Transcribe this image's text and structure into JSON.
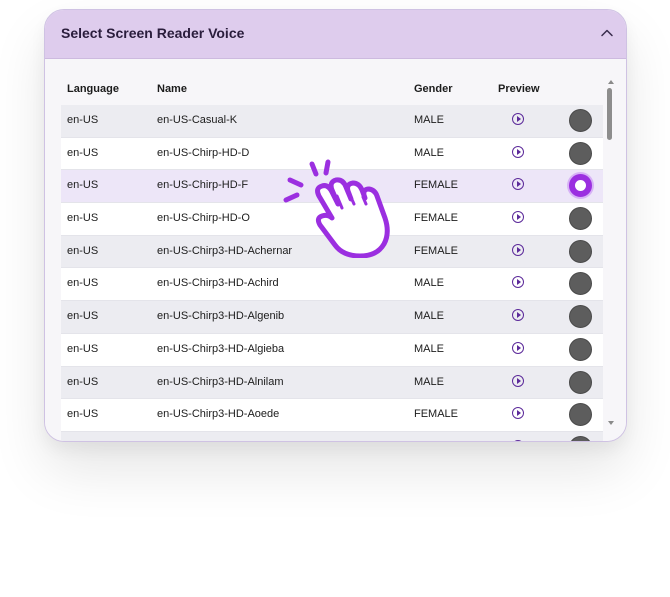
{
  "dialog": {
    "title": "Select Screen Reader Voice",
    "collapse_icon": "chevron-up-icon"
  },
  "table": {
    "headers": {
      "language": "Language",
      "name": "Name",
      "gender": "Gender",
      "preview": "Preview"
    },
    "preview_icon": "play-circle-icon",
    "rows": [
      {
        "language": "en-US",
        "name": "en-US-Casual-K",
        "gender": "MALE",
        "selected": false
      },
      {
        "language": "en-US",
        "name": "en-US-Chirp-HD-D",
        "gender": "MALE",
        "selected": false
      },
      {
        "language": "en-US",
        "name": "en-US-Chirp-HD-F",
        "gender": "FEMALE",
        "selected": true
      },
      {
        "language": "en-US",
        "name": "en-US-Chirp-HD-O",
        "gender": "FEMALE",
        "selected": false
      },
      {
        "language": "en-US",
        "name": "en-US-Chirp3-HD-Achernar",
        "gender": "FEMALE",
        "selected": false
      },
      {
        "language": "en-US",
        "name": "en-US-Chirp3-HD-Achird",
        "gender": "MALE",
        "selected": false
      },
      {
        "language": "en-US",
        "name": "en-US-Chirp3-HD-Algenib",
        "gender": "MALE",
        "selected": false
      },
      {
        "language": "en-US",
        "name": "en-US-Chirp3-HD-Algieba",
        "gender": "MALE",
        "selected": false
      },
      {
        "language": "en-US",
        "name": "en-US-Chirp3-HD-Alnilam",
        "gender": "MALE",
        "selected": false
      },
      {
        "language": "en-US",
        "name": "en-US-Chirp3-HD-Aoede",
        "gender": "FEMALE",
        "selected": false
      },
      {
        "language": "",
        "name": "",
        "gender": "",
        "selected": false
      }
    ]
  },
  "colors": {
    "accent": "#9b2fe0",
    "header_bg": "#decced",
    "selected_row": "#ede6f8"
  },
  "overlay": {
    "icon": "tap-hand-icon"
  }
}
